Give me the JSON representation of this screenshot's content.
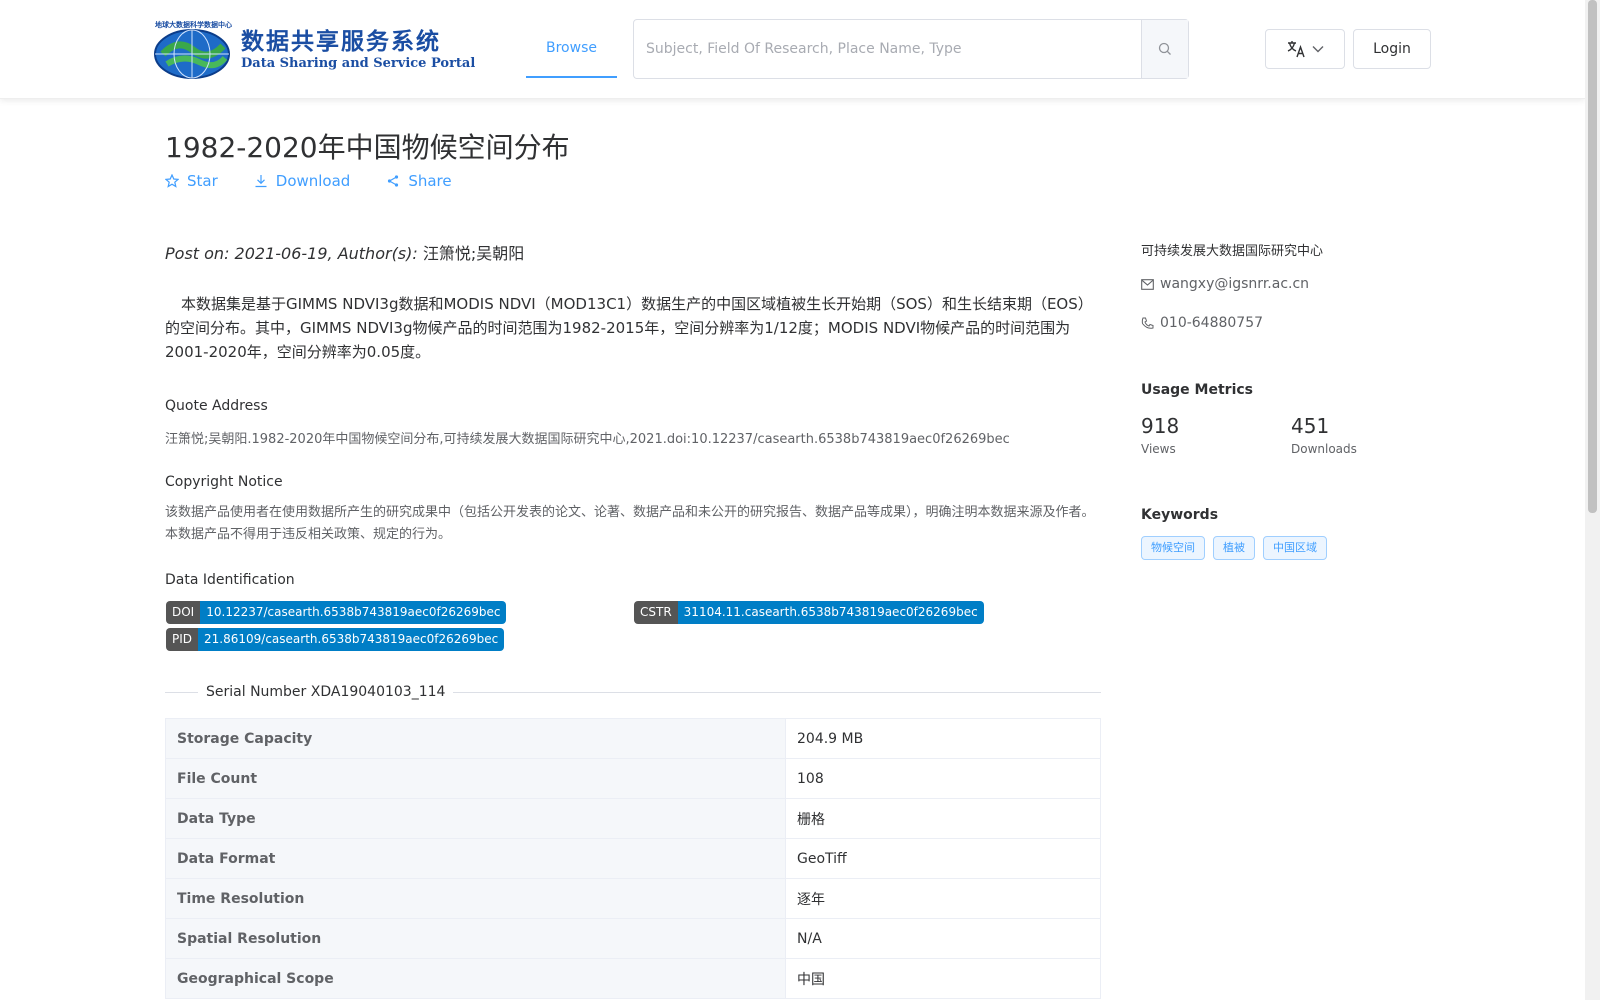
{
  "header": {
    "logo_cn": "数据共享服务系统",
    "logo_en": "Data Sharing and Service Portal",
    "logo_tiny": "地球大数据科学数据中心",
    "nav_browse": "Browse",
    "search_placeholder": "Subject, Field Of Research, Place Name, Type",
    "login_label": "Login"
  },
  "dataset": {
    "title": "1982-2020年中国物候空间分布",
    "actions": {
      "star": "Star",
      "download": "Download",
      "share": "Share"
    },
    "post_on_prefix": "Post on: 2021-06-19, Author(s):",
    "authors": "汪箫悦;吴朝阳",
    "description": "本数据集是基于GIMMS NDVI3g数据和MODIS NDVI（MOD13C1）数据生产的中国区域植被生长开始期（SOS）和生长结束期（EOS）的空间分布。其中，GIMMS NDVI3g物候产品的时间范围为1982-2015年，空间分辨率为1/12度；MODIS NDVI物候产品的时间范围为2001-2020年，空间分辨率为0.05度。",
    "quote_title": "Quote Address",
    "quote_text": "汪箫悦;吴朝阳.1982-2020年中国物候空间分布,可持续发展大数据国际研究中心,2021.doi:10.12237/casearth.6538b743819aec0f26269bec",
    "copyright_title": "Copyright Notice",
    "copyright_text": "该数据产品使用者在使用数据所产生的研究成果中（包括公开发表的论文、论著、数据产品和未公开的研究报告、数据产品等成果），明确注明本数据来源及作者。本数据产品不得用于违反相关政策、规定的行为。",
    "identification_title": "Data Identification",
    "doi": {
      "key": "DOI",
      "value": "10.12237/casearth.6538b743819aec0f26269bec"
    },
    "cstr": {
      "key": "CSTR",
      "value": "31104.11.casearth.6538b743819aec0f26269bec"
    },
    "pid": {
      "key": "PID",
      "value": "21.86109/casearth.6538b743819aec0f26269bec"
    },
    "serial": "Serial Number XDA19040103_114",
    "table": [
      {
        "key": "Storage Capacity",
        "value": "204.9 MB"
      },
      {
        "key": "File Count",
        "value": "108"
      },
      {
        "key": "Data Type",
        "value": "栅格"
      },
      {
        "key": "Data Format",
        "value": "GeoTiff"
      },
      {
        "key": "Time Resolution",
        "value": "逐年"
      },
      {
        "key": "Spatial Resolution",
        "value": "N/A"
      },
      {
        "key": "Geographical Scope",
        "value": "中国"
      }
    ]
  },
  "sidebar": {
    "organization": "可持续发展大数据国际研究中心",
    "email": "wangxy@igsnrr.ac.cn",
    "phone": "010-64880757",
    "usage_title": "Usage Metrics",
    "views_count": "918",
    "views_label": "Views",
    "downloads_count": "451",
    "downloads_label": "Downloads",
    "keywords_title": "Keywords",
    "keywords": [
      "物候空间",
      "植被",
      "中国区域"
    ]
  },
  "colors": {
    "accent": "#409eff",
    "badge_key": "#555555",
    "badge_value": "#007ec6"
  }
}
